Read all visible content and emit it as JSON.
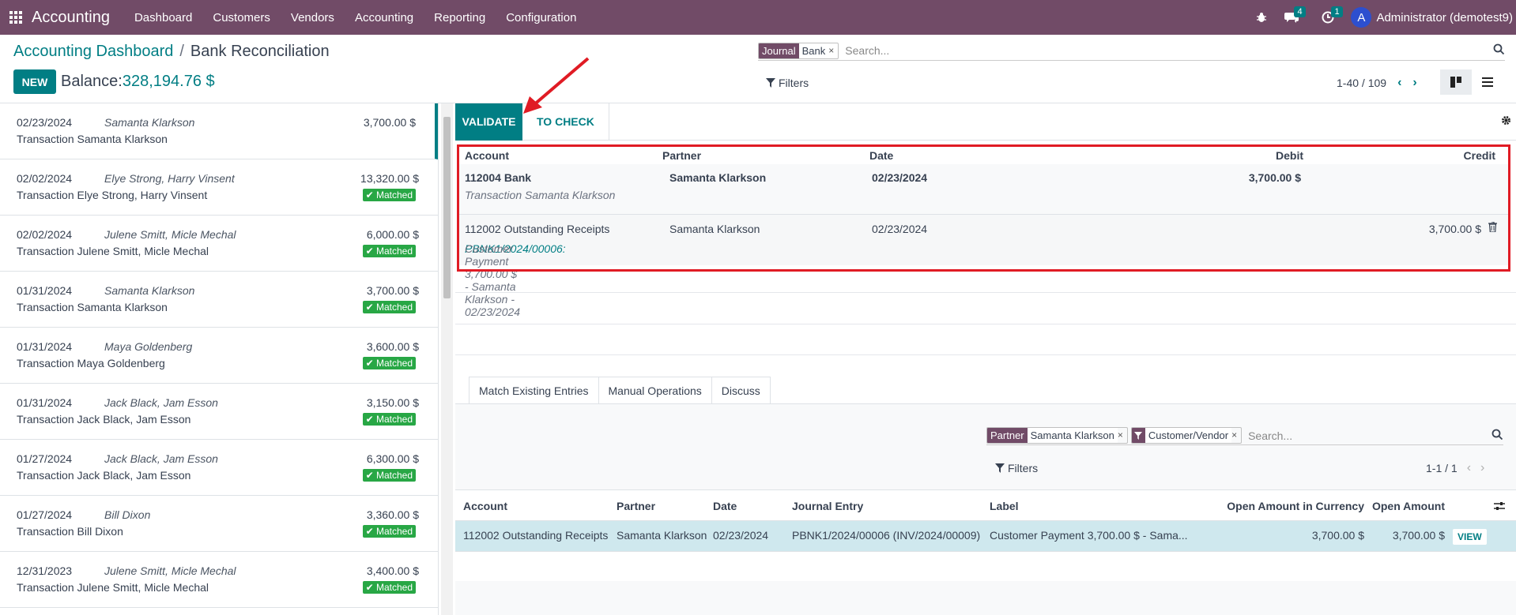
{
  "nav": {
    "brand": "Accounting",
    "menu": [
      "Dashboard",
      "Customers",
      "Vendors",
      "Accounting",
      "Reporting",
      "Configuration"
    ],
    "messages_count": "4",
    "activities_count": "1",
    "avatar_letter": "A",
    "user": "Administrator (demotest9)"
  },
  "header": {
    "breadcrumb_parent": "Accounting Dashboard",
    "breadcrumb_sep": "/",
    "breadcrumb_current": "Bank Reconciliation",
    "new_label": "NEW",
    "balance_label": "Balance:",
    "balance_value": "328,194.76 $"
  },
  "search": {
    "facet_label": "Journal",
    "facet_value": "Bank",
    "facet_remove": "×",
    "placeholder": "Search...",
    "filters_label": "Filters",
    "pager": "1-40 / 109"
  },
  "transactions": [
    {
      "date": "02/23/2024",
      "partner": "Samanta Klarkson",
      "amount": "3,700.00 $",
      "label": "Transaction Samanta Klarkson",
      "matched": ""
    },
    {
      "date": "02/02/2024",
      "partner": "Elye Strong, Harry Vinsent",
      "amount": "13,320.00 $",
      "label": "Transaction Elye Strong, Harry Vinsent",
      "matched": "Matched"
    },
    {
      "date": "02/02/2024",
      "partner": "Julene Smitt, Micle Mechal",
      "amount": "6,000.00 $",
      "label": "Transaction Julene Smitt, Micle Mechal",
      "matched": "Matched"
    },
    {
      "date": "01/31/2024",
      "partner": "Samanta Klarkson",
      "amount": "3,700.00 $",
      "label": "Transaction Samanta Klarkson",
      "matched": "Matched"
    },
    {
      "date": "01/31/2024",
      "partner": "Maya Goldenberg",
      "amount": "3,600.00 $",
      "label": "Transaction Maya Goldenberg",
      "matched": "Matched"
    },
    {
      "date": "01/31/2024",
      "partner": "Jack Black, Jam Esson",
      "amount": "3,150.00 $",
      "label": "Transaction Jack Black, Jam Esson",
      "matched": "Matched"
    },
    {
      "date": "01/27/2024",
      "partner": "Jack Black, Jam Esson",
      "amount": "6,300.00 $",
      "label": "Transaction Jack Black, Jam Esson",
      "matched": "Matched"
    },
    {
      "date": "01/27/2024",
      "partner": "Bill Dixon",
      "amount": "3,360.00 $",
      "label": "Transaction Bill Dixon",
      "matched": "Matched"
    },
    {
      "date": "12/31/2023",
      "partner": "Julene Smitt, Micle Mechal",
      "amount": "3,400.00 $",
      "label": "Transaction Julene Smitt, Micle Mechal",
      "matched": "Matched"
    }
  ],
  "actions": {
    "validate": "VALIDATE",
    "to_check": "TO CHECK"
  },
  "lines": {
    "headers": {
      "account": "Account",
      "partner": "Partner",
      "date": "Date",
      "debit": "Debit",
      "credit": "Credit"
    },
    "row1": {
      "account": "112004 Bank",
      "partner": "Samanta Klarkson",
      "date": "02/23/2024",
      "debit": "3,700.00 $",
      "label": "Transaction Samanta Klarkson"
    },
    "row2": {
      "account": "112002 Outstanding Receipts",
      "partner": "Samanta Klarkson",
      "date": "02/23/2024",
      "credit": "3,700.00 $",
      "ref": "PBNK1/2024/00006:",
      "label": "Customer Payment 3,700.00 $ - Samanta Klarkson - 02/23/2024"
    }
  },
  "tabs": [
    "Match Existing Entries",
    "Manual Operations",
    "Discuss"
  ],
  "match_search": {
    "partner_label": "Partner",
    "partner_value": "Samanta Klarkson",
    "filter_value": "Customer/Vendor",
    "remove": "×",
    "placeholder": "Search...",
    "filters_label": "Filters",
    "pager": "1-1 / 1"
  },
  "match_table": {
    "headers": [
      "Account",
      "Partner",
      "Date",
      "Journal Entry",
      "Label",
      "Open Amount in Currency",
      "Open Amount"
    ],
    "row": {
      "account": "112002 Outstanding Receipts",
      "partner": "Samanta Klarkson",
      "date": "02/23/2024",
      "entry": "PBNK1/2024/00006 (INV/2024/00009)",
      "label": "Customer Payment 3,700.00 $ - Sama...",
      "amount_currency": "3,700.00 $",
      "amount": "3,700.00 $",
      "view": "VIEW"
    }
  },
  "colors": {
    "brand": "#714B67",
    "accent": "#017e84",
    "matched": "#28a745",
    "highlight": "#e01b24"
  }
}
